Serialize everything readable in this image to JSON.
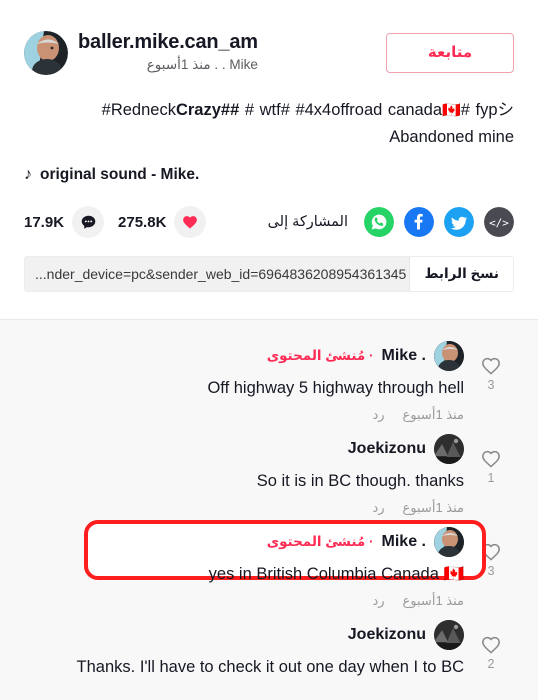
{
  "profile": {
    "follow_label": "متابعة",
    "username": "baller.mike.can_am",
    "subtitle": "Mike . . منذ 1أسبوع",
    "avatar_name": "profile-avatar"
  },
  "post": {
    "caption_line1_prefix": "Redneck",
    "caption_line1_bold": "Crazy##",
    "caption_line1_rest": " # wtf# #4x4offroad canada",
    "caption_flag": "🇨🇦",
    "caption_line1_tail": "# fypシ#",
    "caption_line2": "Abandoned mine",
    "music_text": ".original sound - Mike",
    "music_icon": "music-note-icon"
  },
  "share": {
    "label": "المشاركة إلى",
    "icons": [
      {
        "name": "embed-icon",
        "glyph": "</>",
        "color": "#4a4a52"
      },
      {
        "name": "twitter-icon",
        "glyph": "",
        "color": "#1da1f2"
      },
      {
        "name": "facebook-icon",
        "glyph": "",
        "color": "#1877f2"
      },
      {
        "name": "whatsapp-icon",
        "glyph": "",
        "color": "#25d366"
      }
    ]
  },
  "stats": {
    "comments_count": "17.9K",
    "likes_count": "275.8K",
    "comment_icon": "comment-bubble-icon",
    "like_icon": "heart-icon",
    "heart_color": "#fe2c55"
  },
  "link": {
    "copy_label": "نسخ الرابط",
    "url": "...nder_device=pc&sender_web_id=6964836208954361345"
  },
  "comments": [
    {
      "name": "Mike .",
      "badge": "مُنشئ المحتوى",
      "text": "Off highway 5 highway through hell",
      "time": "منذ 1أسبوع",
      "reply": "رد",
      "likes": "3",
      "avatar": "mike-avatar",
      "highlighted": false
    },
    {
      "name": "Joekizonu",
      "badge": "",
      "text": "So it is in BC though. thanks",
      "time": "منذ 1أسبوع",
      "reply": "رد",
      "likes": "1",
      "avatar": "joekizonu-avatar",
      "highlighted": false
    },
    {
      "name": "Mike .",
      "badge": "مُنشئ المحتوى",
      "text": "yes in British Columbia Canada 🇨🇦",
      "time": "منذ 1أسبوع",
      "reply": "رد",
      "likes": "3",
      "avatar": "mike-avatar",
      "highlighted": true
    },
    {
      "name": "Joekizonu",
      "badge": "",
      "text": "Thanks. I'll have to check it out one day when I to BC",
      "time": "",
      "reply": "",
      "likes": "2",
      "avatar": "joekizonu-avatar",
      "highlighted": false
    }
  ],
  "colors": {
    "accent": "#fe2c55",
    "highlight_box": "#ff1d1d",
    "comments_bg": "#f8f8f8"
  }
}
